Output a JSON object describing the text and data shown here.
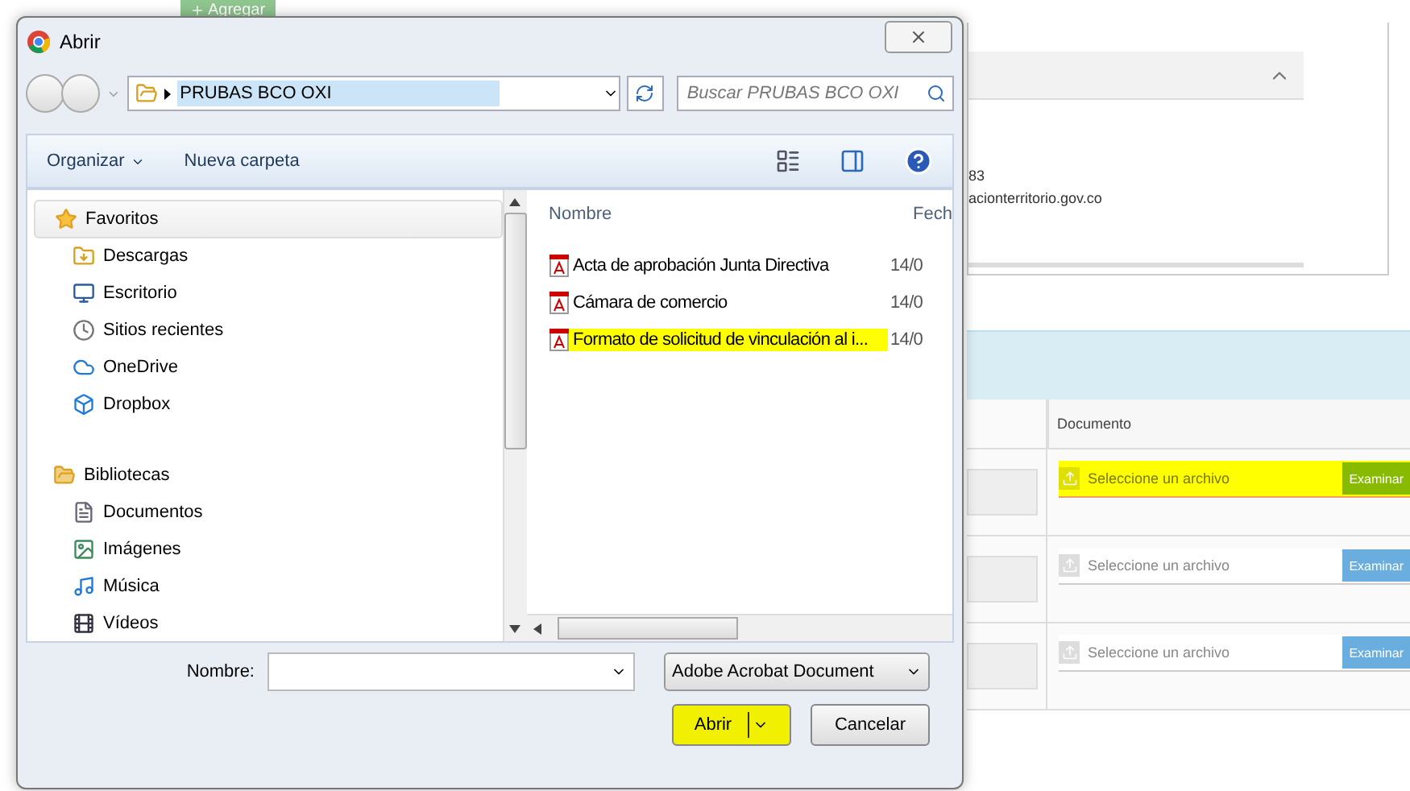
{
  "background_page": {
    "add_button": "Agregar",
    "info_lines": [
      "83",
      "acionterritorio.gov.co"
    ],
    "documents_table": {
      "columns": [
        "Documento"
      ],
      "rows": [
        {
          "placeholder": "Seleccione un archivo",
          "button": "Examinar",
          "highlighted": true
        },
        {
          "placeholder": "Seleccione un archivo",
          "button": "Examinar",
          "highlighted": false
        },
        {
          "placeholder": "Seleccione un archivo",
          "button": "Examinar",
          "highlighted": false
        }
      ]
    }
  },
  "dialog": {
    "title": "Abrir",
    "path": "PRUBAS BCO OXI",
    "search": {
      "placeholder": "Buscar PRUBAS BCO OXI"
    },
    "toolbar": [
      "Organizar",
      "Nueva carpeta"
    ],
    "nav": [
      {
        "label": "Favoritos",
        "children": [
          {
            "label": "Descargas"
          },
          {
            "label": "Escritorio"
          },
          {
            "label": "Sitios recientes"
          },
          {
            "label": "OneDrive"
          },
          {
            "label": "Dropbox"
          }
        ]
      },
      {
        "label": "Bibliotecas",
        "children": [
          {
            "label": "Documentos"
          },
          {
            "label": "Imágenes"
          },
          {
            "label": "Música"
          },
          {
            "label": "Vídeos"
          }
        ]
      }
    ],
    "columns": [
      "Nombre",
      "Fech"
    ],
    "files": [
      {
        "name": "Acta de aprobación Junta Directiva",
        "date": "14/0",
        "highlighted": false
      },
      {
        "name": "Cámara de comercio",
        "date": "14/0",
        "highlighted": false
      },
      {
        "name": "Formato de solicitud de vinculación al i...",
        "date": "14/0",
        "highlighted": true
      }
    ],
    "filename": {
      "label": "Nombre:"
    },
    "file_type": "Adobe Acrobat Document",
    "open_button": {
      "label": "Abrir",
      "highlighted": true
    },
    "cancel_button": "Cancelar"
  }
}
